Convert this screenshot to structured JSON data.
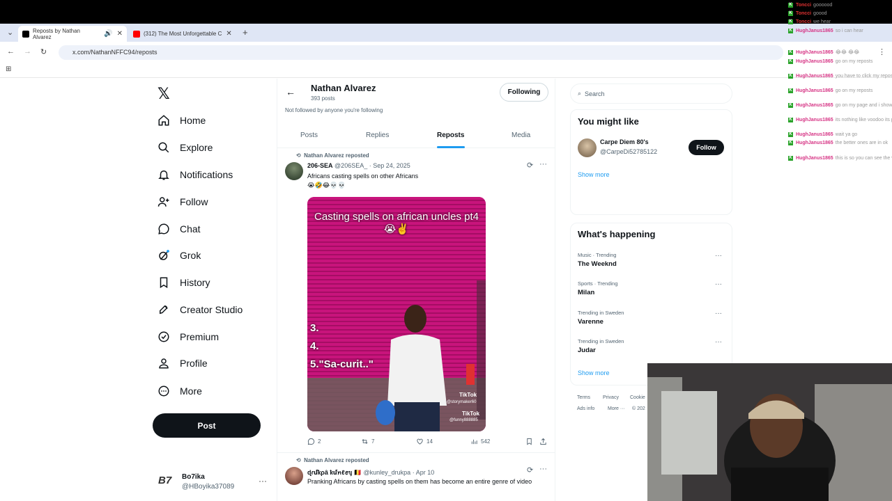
{
  "browser": {
    "tabs": [
      {
        "label": "Reposts by Nathan Alvarez",
        "active": true
      },
      {
        "label": "(312) The Most Unforgettable C",
        "active": false
      }
    ],
    "url": "x.com/NathanNFFC94/reposts"
  },
  "nav": {
    "logo": "𝕏",
    "items": [
      {
        "label": "Home",
        "icon": "home-icon"
      },
      {
        "label": "Explore",
        "icon": "search-icon"
      },
      {
        "label": "Notifications",
        "icon": "bell-icon"
      },
      {
        "label": "Follow",
        "icon": "follow-icon"
      },
      {
        "label": "Chat",
        "icon": "chat-icon"
      },
      {
        "label": "Grok",
        "icon": "grok-icon"
      },
      {
        "label": "History",
        "icon": "bookmark-icon"
      },
      {
        "label": "Creator Studio",
        "icon": "rocket-icon"
      },
      {
        "label": "Premium",
        "icon": "verified-icon"
      },
      {
        "label": "Profile",
        "icon": "person-icon"
      },
      {
        "label": "More",
        "icon": "more-circle-icon"
      }
    ],
    "post_label": "Post",
    "account": {
      "avatar": "B7",
      "name": "Bo7ika",
      "handle": "@HBoyika37089",
      "more": "···"
    }
  },
  "profile": {
    "name": "Nathan Alvarez",
    "post_count": "393 posts",
    "followed_by": "Not followed by anyone you're following",
    "following_label": "Following",
    "tabs": [
      "Posts",
      "Replies",
      "Reposts",
      "Media"
    ]
  },
  "tweets": [
    {
      "repost_label": "Nathan Alvarez reposted",
      "name": "206-SEA",
      "handle": "@206SEA_",
      "date": "Sep 24, 2025",
      "text": "Africans casting spells on other Africans",
      "emoji": "😭🤣😂💀💀",
      "media": {
        "caption": "Casting spells on african uncles pt4 😭✌️",
        "list": [
          "3.",
          "4.",
          "5.\"Sa-curit..\""
        ],
        "watermark": "TikTok",
        "tag1": "@storymaker60",
        "watermark2": "TikTok",
        "tag2": "@funny888885"
      },
      "replies": "2",
      "reposts": "7",
      "likes": "14",
      "views": "542"
    },
    {
      "repost_label": "Nathan Alvarez reposted",
      "name": "ɖɾմҟρâ ҟմꪀℓꫀᥡ 🇧🇪",
      "handle": "@kunley_drukpa",
      "date": "Apr 10",
      "text": "Pranking Africans by casting spells on them has become an entire genre of video"
    }
  ],
  "sidebar": {
    "search_placeholder": "Search",
    "might_like_title": "You might like",
    "suggestion": {
      "name": "Carpe Diem 80's",
      "handle": "@CarpeDi52785122",
      "follow_label": "Follow"
    },
    "show_more": "Show more",
    "happening_title": "What's happening",
    "trends": [
      {
        "category": "Music · Trending",
        "name": "The Weeknd"
      },
      {
        "category": "Sports · Trending",
        "name": "Milan"
      },
      {
        "category": "Trending in Sweden",
        "name": "Varenne"
      },
      {
        "category": "Trending in Sweden",
        "name": "Judar"
      }
    ],
    "show_more_2": "Show more",
    "footer1": [
      "Terms",
      "Privacy",
      "Cookie"
    ],
    "footer2": [
      "Ads info",
      "More ···",
      "© 202"
    ]
  },
  "chat": [
    {
      "user": "Toncci",
      "msg": "goooood",
      "color": "#e03131"
    },
    {
      "user": "Toncci",
      "msg": "goood",
      "color": "#e03131"
    },
    {
      "user": "Toncci",
      "msg": "we hear",
      "color": "#e03131"
    },
    {
      "user": "HughJanus1865",
      "msg": "so i can hear",
      "color": "#d63384"
    },
    {
      "user": "HughJanus1865",
      "msg": "😂😂 😂😂",
      "color": "#d63384"
    },
    {
      "user": "HughJanus1865",
      "msg": "go on my reposts",
      "color": "#d63384"
    },
    {
      "user": "HughJanus1865",
      "msg": "you have to click my reposts",
      "color": "#d63384"
    },
    {
      "user": "HughJanus1865",
      "msg": "go on my reposts",
      "color": "#d63384"
    },
    {
      "user": "HughJanus1865",
      "msg": "go on my page and i show you",
      "color": "#d63384"
    },
    {
      "user": "HughJanus1865",
      "msg": "its nothing like voodoo its pranks its funny",
      "color": "#d63384"
    },
    {
      "user": "HughJanus1865",
      "msg": "wait ya go",
      "color": "#d63384"
    },
    {
      "user": "HughJanus1865",
      "msg": "the better ones are in ok",
      "color": "#d63384"
    },
    {
      "user": "HughJanus1865",
      "msg": "this is so you can see the vibe 😂😂😂😂",
      "color": "#d63384"
    }
  ]
}
